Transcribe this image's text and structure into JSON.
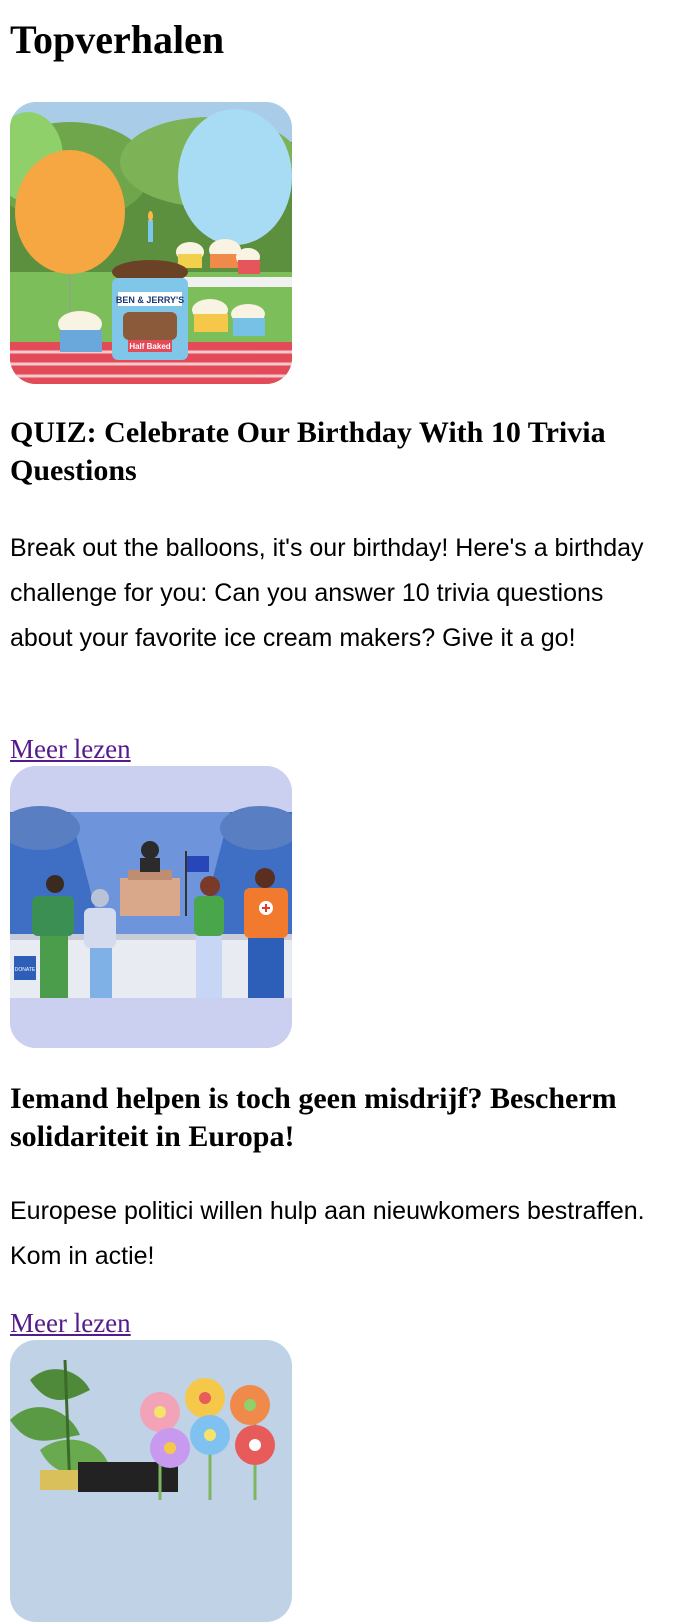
{
  "page": {
    "title": "Topverhalen"
  },
  "stories": [
    {
      "title": "QUIZ: Celebrate Our Birthday With 10 Trivia Questions",
      "text": "Break out the balloons, it's our birthday! Here's a birthday challenge for you: Can you answer 10 trivia questions about your favorite ice cream makers? Give it a go!",
      "link": "Meer lezen",
      "image": {
        "brand": "BEN & JERRY'S",
        "product": "Half Baked"
      }
    },
    {
      "title": "Iemand helpen is toch geen misdrijf? Bescherm solidariteit in Europa!",
      "text": "Europese politici willen hulp aan nieuwkomers bestraffen. Kom in actie!",
      "link": "Meer lezen",
      "image": {
        "label": "DONATE"
      }
    },
    {
      "title": "",
      "text": "",
      "link": "",
      "image": {}
    }
  ],
  "colors": {
    "link": "#551a8b",
    "card2_background": "#ccd0f0"
  }
}
